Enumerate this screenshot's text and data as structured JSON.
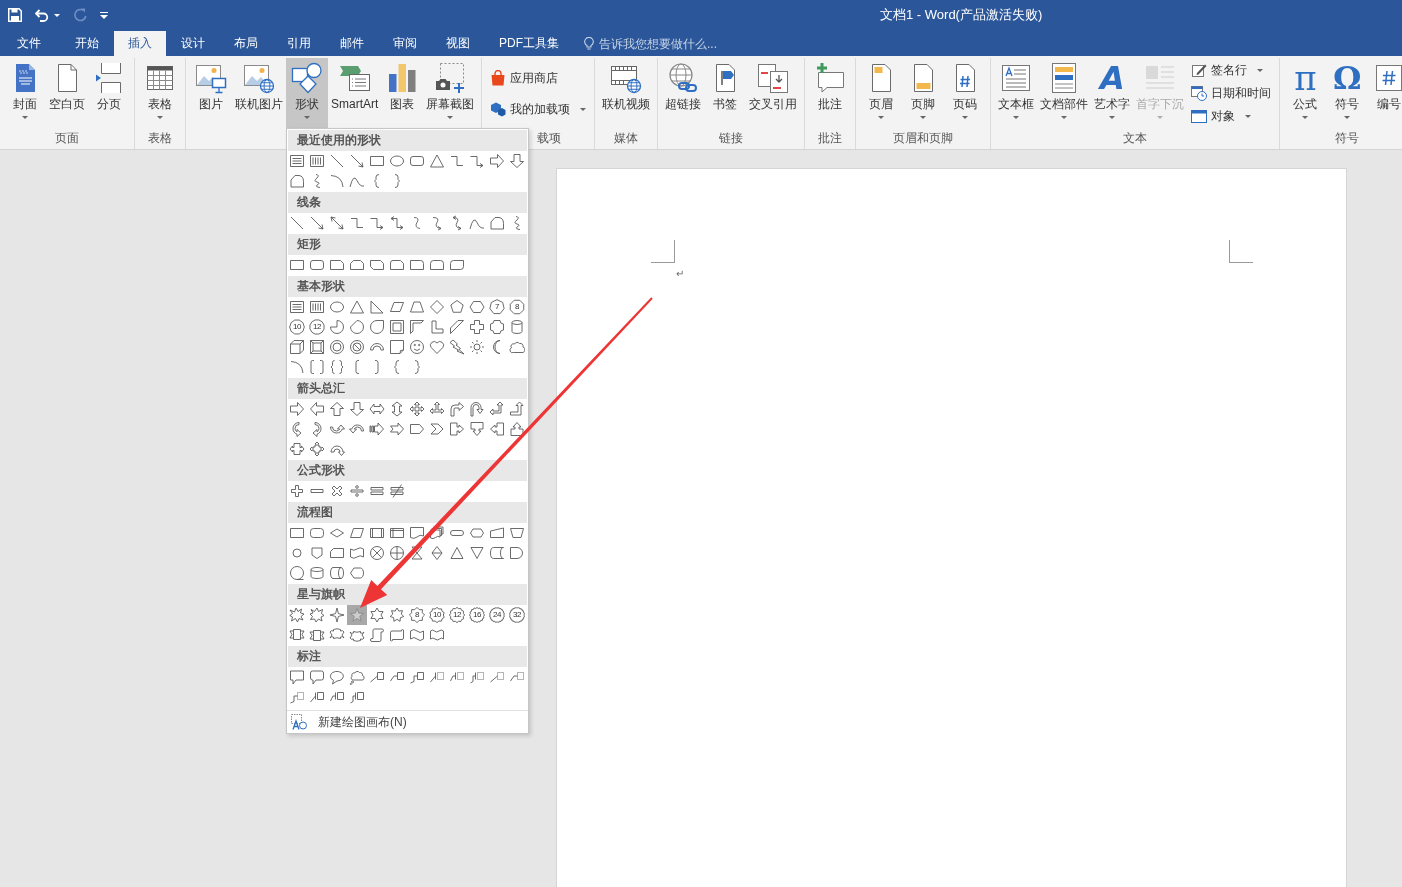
{
  "title_bar": {
    "quick_access": [
      {
        "disabled": false,
        "dropdown": false
      },
      {
        "disabled": false,
        "dropdown": true
      },
      {
        "disabled": true,
        "dropdown": false
      },
      {
        "disabled": false,
        "dropdown": false
      }
    ],
    "title": "文档1 - Word(产品激活失败)"
  },
  "tabs": [
    {
      "label": "文件",
      "selected": false
    },
    {
      "label": "开始",
      "selected": false
    },
    {
      "label": "插入",
      "selected": true
    },
    {
      "label": "设计",
      "selected": false
    },
    {
      "label": "布局",
      "selected": false
    },
    {
      "label": "引用",
      "selected": false
    },
    {
      "label": "邮件",
      "selected": false
    },
    {
      "label": "审阅",
      "selected": false
    },
    {
      "label": "视图",
      "selected": false
    },
    {
      "label": "PDF工具集",
      "selected": false
    }
  ],
  "tell_me": {
    "placeholder": "告诉我您想要做什么..."
  },
  "ribbon": {
    "groups": [
      {
        "label": "页面",
        "buttons": [
          {
            "kind": "large",
            "label": "封面",
            "dropdown": true,
            "pressed": false,
            "disabled": false
          },
          {
            "kind": "large",
            "label": "空白页",
            "dropdown": false,
            "pressed": false,
            "disabled": false
          },
          {
            "kind": "large",
            "label": "分页",
            "dropdown": false,
            "pressed": false,
            "disabled": false
          }
        ]
      },
      {
        "label": "表格",
        "buttons": [
          {
            "kind": "large",
            "label": "表格",
            "dropdown": true,
            "pressed": false,
            "disabled": false
          }
        ]
      },
      {
        "buttons": [
          {
            "kind": "large",
            "label": "图片",
            "dropdown": false,
            "pressed": false,
            "disabled": false
          },
          {
            "kind": "large",
            "label": "联机图片",
            "dropdown": false,
            "pressed": false,
            "disabled": false
          },
          {
            "kind": "large",
            "label": "形状",
            "dropdown": true,
            "pressed": true,
            "disabled": false
          },
          {
            "kind": "large",
            "label": "SmartArt",
            "dropdown": false,
            "pressed": false,
            "disabled": false
          },
          {
            "kind": "large",
            "label": "图表",
            "dropdown": false,
            "pressed": false,
            "disabled": false
          },
          {
            "kind": "large",
            "label": "屏幕截图",
            "dropdown": true,
            "pressed": false,
            "disabled": false
          }
        ]
      },
      {
        "label": "载项",
        "buttons": [
          {
            "kind": "small",
            "label": "应用商店",
            "dropdown": false,
            "pressed": false,
            "disabled": false
          },
          {
            "kind": "small",
            "label": "我的加载项",
            "dropdown": true,
            "pressed": false,
            "disabled": false
          }
        ]
      },
      {
        "label": "媒体",
        "buttons": [
          {
            "kind": "large",
            "label": "联机视频",
            "dropdown": false,
            "pressed": false,
            "disabled": false
          }
        ]
      },
      {
        "label": "链接",
        "buttons": [
          {
            "kind": "large",
            "label": "超链接",
            "dropdown": false,
            "pressed": false,
            "disabled": false
          },
          {
            "kind": "large",
            "label": "书签",
            "dropdown": false,
            "pressed": false,
            "disabled": false
          },
          {
            "kind": "large",
            "label": "交叉引用",
            "dropdown": false,
            "pressed": false,
            "disabled": false
          }
        ]
      },
      {
        "label": "批注",
        "buttons": [
          {
            "kind": "large",
            "label": "批注",
            "dropdown": false,
            "pressed": false,
            "disabled": false
          }
        ]
      },
      {
        "label": "页眉和页脚",
        "buttons": [
          {
            "kind": "large",
            "label": "页眉",
            "dropdown": true,
            "pressed": false,
            "disabled": false
          },
          {
            "kind": "large",
            "label": "页脚",
            "dropdown": true,
            "pressed": false,
            "disabled": false
          },
          {
            "kind": "large",
            "label": "页码",
            "dropdown": true,
            "pressed": false,
            "disabled": false
          }
        ]
      },
      {
        "label": "文本",
        "buttons": [
          {
            "kind": "large",
            "label": "文本框",
            "dropdown": true,
            "pressed": false,
            "disabled": false
          },
          {
            "kind": "large",
            "label": "文档部件",
            "dropdown": true,
            "pressed": false,
            "disabled": false
          },
          {
            "kind": "large",
            "glyph": "A",
            "label": "艺术字",
            "dropdown": true,
            "pressed": false,
            "disabled": false
          },
          {
            "kind": "large",
            "label": "首字下沉",
            "dropdown": true,
            "pressed": false,
            "disabled": true
          },
          {
            "kind": "small",
            "label": "签名行",
            "dropdown": true,
            "pressed": false,
            "disabled": false
          },
          {
            "kind": "small",
            "label": "日期和时间",
            "dropdown": false,
            "pressed": false,
            "disabled": false
          },
          {
            "kind": "small",
            "label": "对象",
            "dropdown": true,
            "pressed": false,
            "disabled": false
          }
        ]
      },
      {
        "label": "符号",
        "buttons": [
          {
            "kind": "large",
            "glyph": "π",
            "label": "公式",
            "dropdown": true,
            "pressed": false,
            "disabled": false
          },
          {
            "kind": "large",
            "glyph": "Ω",
            "label": "符号",
            "dropdown": true,
            "pressed": false,
            "disabled": false
          },
          {
            "kind": "large",
            "label": "编号",
            "dropdown": false,
            "pressed": false,
            "disabled": false
          }
        ]
      }
    ]
  },
  "shapes_menu": {
    "sections": [
      {
        "title": "最近使用的形状",
        "items": [
          {
            "selected": false
          },
          {
            "selected": false
          },
          {
            "selected": false
          },
          {
            "selected": false
          },
          {
            "selected": false
          },
          {
            "selected": false
          },
          {
            "selected": false
          },
          {
            "selected": false
          },
          {
            "selected": false
          },
          {
            "selected": false
          },
          {
            "selected": false
          },
          {
            "selected": false
          },
          {
            "selected": false
          },
          {
            "selected": false
          },
          {
            "selected": false
          },
          {
            "selected": false
          },
          {
            "selected": false
          },
          {
            "selected": false
          }
        ]
      },
      {
        "title": "线条",
        "items": [
          {
            "selected": false
          },
          {
            "selected": false
          },
          {
            "selected": false
          },
          {
            "selected": false
          },
          {
            "selected": false
          },
          {
            "selected": false
          },
          {
            "selected": false
          },
          {
            "selected": false
          },
          {
            "selected": false
          },
          {
            "selected": false
          },
          {
            "selected": false
          },
          {
            "selected": false
          }
        ]
      },
      {
        "title": "矩形",
        "items": [
          {
            "selected": false
          },
          {
            "selected": false
          },
          {
            "selected": false
          },
          {
            "selected": false
          },
          {
            "selected": false
          },
          {
            "selected": false
          },
          {
            "selected": false
          },
          {
            "selected": false
          },
          {
            "selected": false
          }
        ]
      },
      {
        "title": "基本形状",
        "items": [
          {
            "selected": false
          },
          {
            "selected": false
          },
          {
            "selected": false
          },
          {
            "selected": false
          },
          {
            "selected": false
          },
          {
            "selected": false
          },
          {
            "selected": false
          },
          {
            "selected": false
          },
          {
            "selected": false
          },
          {
            "selected": false
          },
          {
            "selected": false,
            "text": "7"
          },
          {
            "selected": false,
            "text": "8"
          },
          {
            "selected": false,
            "text": "10"
          },
          {
            "selected": false,
            "text": "12"
          },
          {
            "selected": false
          },
          {
            "selected": false
          },
          {
            "selected": false
          },
          {
            "selected": false
          },
          {
            "selected": false
          },
          {
            "selected": false
          },
          {
            "selected": false
          },
          {
            "selected": false
          },
          {
            "selected": false
          },
          {
            "selected": false
          },
          {
            "selected": false
          },
          {
            "selected": false
          },
          {
            "selected": false
          },
          {
            "selected": false
          },
          {
            "selected": false
          },
          {
            "selected": false
          },
          {
            "selected": false
          },
          {
            "selected": false
          },
          {
            "selected": false
          },
          {
            "selected": false
          },
          {
            "selected": false
          },
          {
            "selected": false
          },
          {
            "selected": false
          },
          {
            "selected": false
          },
          {
            "selected": false
          },
          {
            "selected": false
          },
          {
            "selected": false
          },
          {
            "selected": false
          },
          {
            "selected": false
          }
        ]
      },
      {
        "title": "箭头总汇",
        "items": [
          {
            "selected": false
          },
          {
            "selected": false
          },
          {
            "selected": false
          },
          {
            "selected": false
          },
          {
            "selected": false
          },
          {
            "selected": false
          },
          {
            "selected": false
          },
          {
            "selected": false
          },
          {
            "selected": false
          },
          {
            "selected": false
          },
          {
            "selected": false
          },
          {
            "selected": false
          },
          {
            "selected": false
          },
          {
            "selected": false
          },
          {
            "selected": false
          },
          {
            "selected": false
          },
          {
            "selected": false
          },
          {
            "selected": false
          },
          {
            "selected": false
          },
          {
            "selected": false
          },
          {
            "selected": false
          },
          {
            "selected": false
          },
          {
            "selected": false
          },
          {
            "selected": false
          },
          {
            "selected": false
          },
          {
            "selected": false
          },
          {
            "selected": false
          }
        ]
      },
      {
        "title": "公式形状",
        "items": [
          {
            "selected": false
          },
          {
            "selected": false
          },
          {
            "selected": false
          },
          {
            "selected": false
          },
          {
            "selected": false
          },
          {
            "selected": false
          }
        ]
      },
      {
        "title": "流程图",
        "items": [
          {
            "selected": false
          },
          {
            "selected": false
          },
          {
            "selected": false
          },
          {
            "selected": false
          },
          {
            "selected": false
          },
          {
            "selected": false
          },
          {
            "selected": false
          },
          {
            "selected": false
          },
          {
            "selected": false
          },
          {
            "selected": false
          },
          {
            "selected": false
          },
          {
            "selected": false
          },
          {
            "selected": false
          },
          {
            "selected": false
          },
          {
            "selected": false
          },
          {
            "selected": false
          },
          {
            "selected": false
          },
          {
            "selected": false
          },
          {
            "selected": false
          },
          {
            "selected": false
          },
          {
            "selected": false
          },
          {
            "selected": false
          },
          {
            "selected": false
          },
          {
            "selected": false
          },
          {
            "selected": false
          },
          {
            "selected": false
          },
          {
            "selected": false
          },
          {
            "selected": false
          }
        ]
      },
      {
        "title": "星与旗帜",
        "items": [
          {
            "selected": false
          },
          {
            "selected": false
          },
          {
            "selected": false
          },
          {
            "selected": true
          },
          {
            "selected": false
          },
          {
            "selected": false
          },
          {
            "selected": false,
            "text": "8"
          },
          {
            "selected": false,
            "text": "10"
          },
          {
            "selected": false,
            "text": "12"
          },
          {
            "selected": false,
            "text": "16"
          },
          {
            "selected": false,
            "text": "24"
          },
          {
            "selected": false,
            "text": "32"
          },
          {
            "selected": false
          },
          {
            "selected": false
          },
          {
            "selected": false
          },
          {
            "selected": false
          },
          {
            "selected": false
          },
          {
            "selected": false
          },
          {
            "selected": false
          },
          {
            "selected": false
          }
        ]
      },
      {
        "title": "标注",
        "items": [
          {
            "selected": false
          },
          {
            "selected": false
          },
          {
            "selected": false
          },
          {
            "selected": false
          },
          {
            "selected": false
          },
          {
            "selected": false
          },
          {
            "selected": false
          },
          {
            "selected": false
          },
          {
            "selected": false
          },
          {
            "selected": false
          },
          {
            "selected": false
          },
          {
            "selected": false
          },
          {
            "selected": false
          },
          {
            "selected": false
          },
          {
            "selected": false
          },
          {
            "selected": false
          }
        ]
      }
    ],
    "footer": {
      "label": "新建绘图画布(N)"
    }
  },
  "document": {
    "paragraph_mark": "↵"
  }
}
